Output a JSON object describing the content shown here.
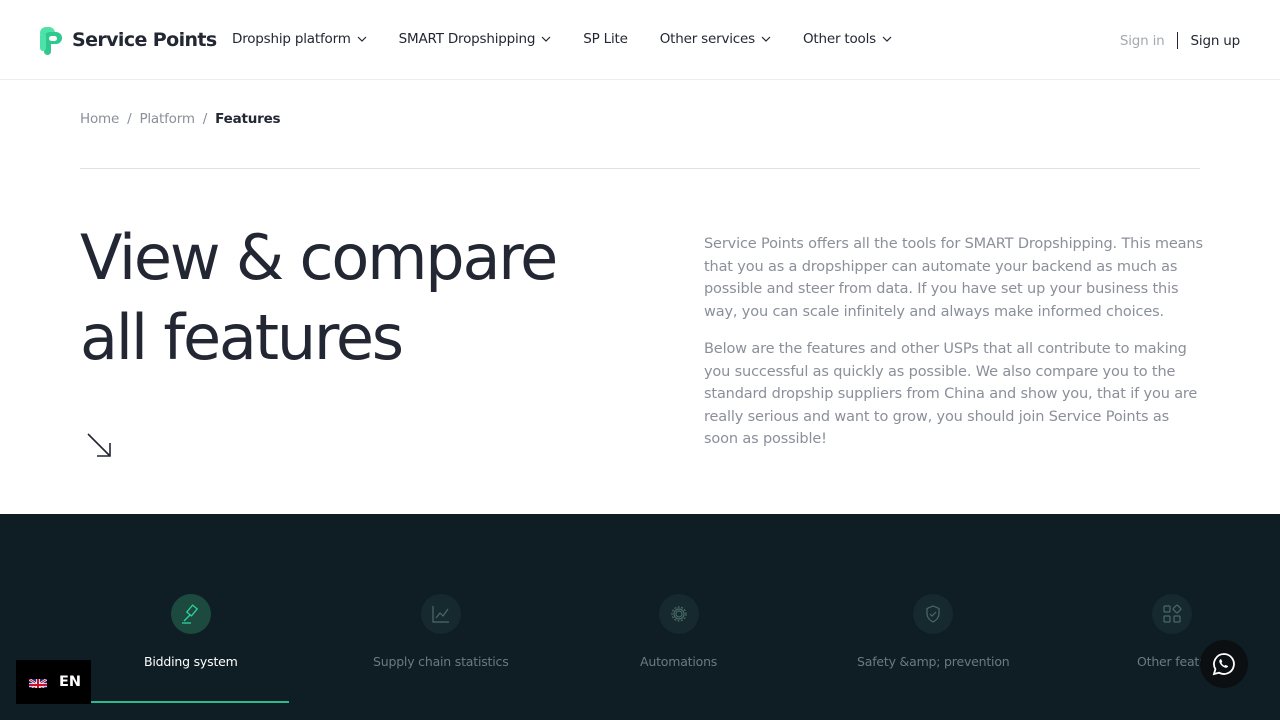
{
  "brand": {
    "name": "Service Points",
    "accent": "#2fd39a"
  },
  "nav": {
    "items": [
      {
        "label": "Dropship platform",
        "dropdown": true
      },
      {
        "label": "SMART Dropshipping",
        "dropdown": true
      },
      {
        "label": "SP Lite",
        "dropdown": false
      },
      {
        "label": "Other services",
        "dropdown": true
      },
      {
        "label": "Other tools",
        "dropdown": true
      }
    ],
    "sign_in": "Sign in",
    "sign_up": "Sign up"
  },
  "breadcrumb": {
    "items": [
      "Home",
      "Platform",
      "Features"
    ],
    "separator": "/"
  },
  "hero": {
    "title_line1": "View & compare",
    "title_line2": "all features",
    "paragraph1": "Service Points offers all the tools for SMART Dropshipping. This means that you as a dropshipper can automate your backend as much as possible and steer from data. If you have set up your business this way, you can scale infinitely and always make informed choices.",
    "paragraph2": "Below are the features and other USPs that all contribute to making you successful as quickly as possible. We also compare you to the standard dropship suppliers from China and show you, that if you are really serious and want to grow, you should join Service Points as soon as possible!"
  },
  "feature_tabs": [
    {
      "label": "Bidding system",
      "icon": "gavel-icon",
      "active": true
    },
    {
      "label": "Supply chain statistics",
      "icon": "line-chart-icon",
      "active": false
    },
    {
      "label": "Automations",
      "icon": "gear-icon",
      "active": false
    },
    {
      "label": "Safety &amp; prevention",
      "icon": "shield-check-icon",
      "active": false
    },
    {
      "label": "Other featu",
      "icon": "grid-icon",
      "active": false
    }
  ],
  "language": {
    "code": "EN",
    "flag": "uk-flag-icon"
  },
  "colors": {
    "dark_band": "#0f1d24",
    "active_tab": "#2fb98a"
  }
}
